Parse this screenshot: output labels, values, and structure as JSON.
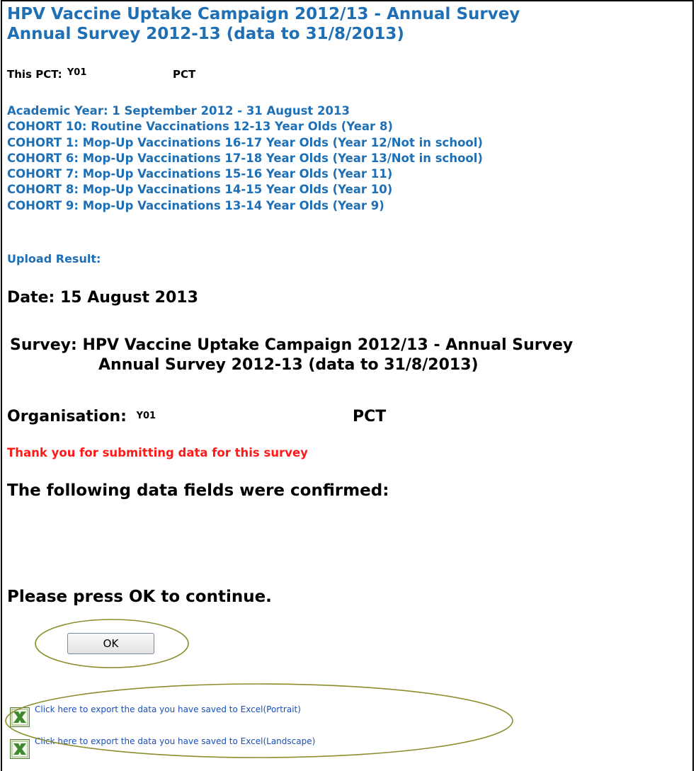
{
  "header": {
    "title_line1": "HPV Vaccine Uptake Campaign 2012/13 - Annual Survey",
    "title_line2": "Annual Survey 2012-13 (data to 31/8/2013)"
  },
  "pct_info": {
    "label": "This PCT:",
    "code": "Y01",
    "name": "PCT"
  },
  "cohorts": [
    "Academic Year: 1 September 2012 - 31 August 2013",
    "COHORT 10: Routine Vaccinations 12-13 Year Olds (Year 8)",
    "COHORT 1: Mop-Up Vaccinations 16-17 Year Olds (Year 12/Not in school)",
    "COHORT 6: Mop-Up Vaccinations 17-18 Year Olds (Year 13/Not in school)",
    "COHORT 7: Mop-Up Vaccinations 15-16 Year Olds (Year 11)",
    "COHORT 8: Mop-Up Vaccinations 14-15 Year Olds (Year 10)",
    "COHORT 9: Mop-Up Vaccinations 13-14 Year Olds (Year 9)"
  ],
  "upload": {
    "label": "Upload Result:"
  },
  "result": {
    "date": "Date: 15 August 2013",
    "survey_label": "Survey:",
    "survey_line1": "HPV Vaccine Uptake Campaign 2012/13 - Annual Survey",
    "survey_line2": "Annual Survey 2012-13 (data to 31/8/2013)",
    "org_label": "Organisation:",
    "org_code": "Y01",
    "org_name": "PCT",
    "thanks": "Thank you for submitting data for this survey",
    "confirmed": "The following data fields were confirmed:",
    "press_ok": "Please press OK to continue."
  },
  "ok_button": {
    "label": "OK"
  },
  "exports": {
    "portrait_label": "Click here to export the data you have saved to Excel(Portrait)",
    "landscape_label": "Click here to export the data you have saved to Excel(Landscape)",
    "icon": "excel-icon"
  },
  "colors": {
    "heading_blue": "#1f6fb5",
    "thanks_red": "#ff1a1a",
    "link_blue": "#1a4fb8",
    "annotation_olive": "#8c8c2a"
  }
}
